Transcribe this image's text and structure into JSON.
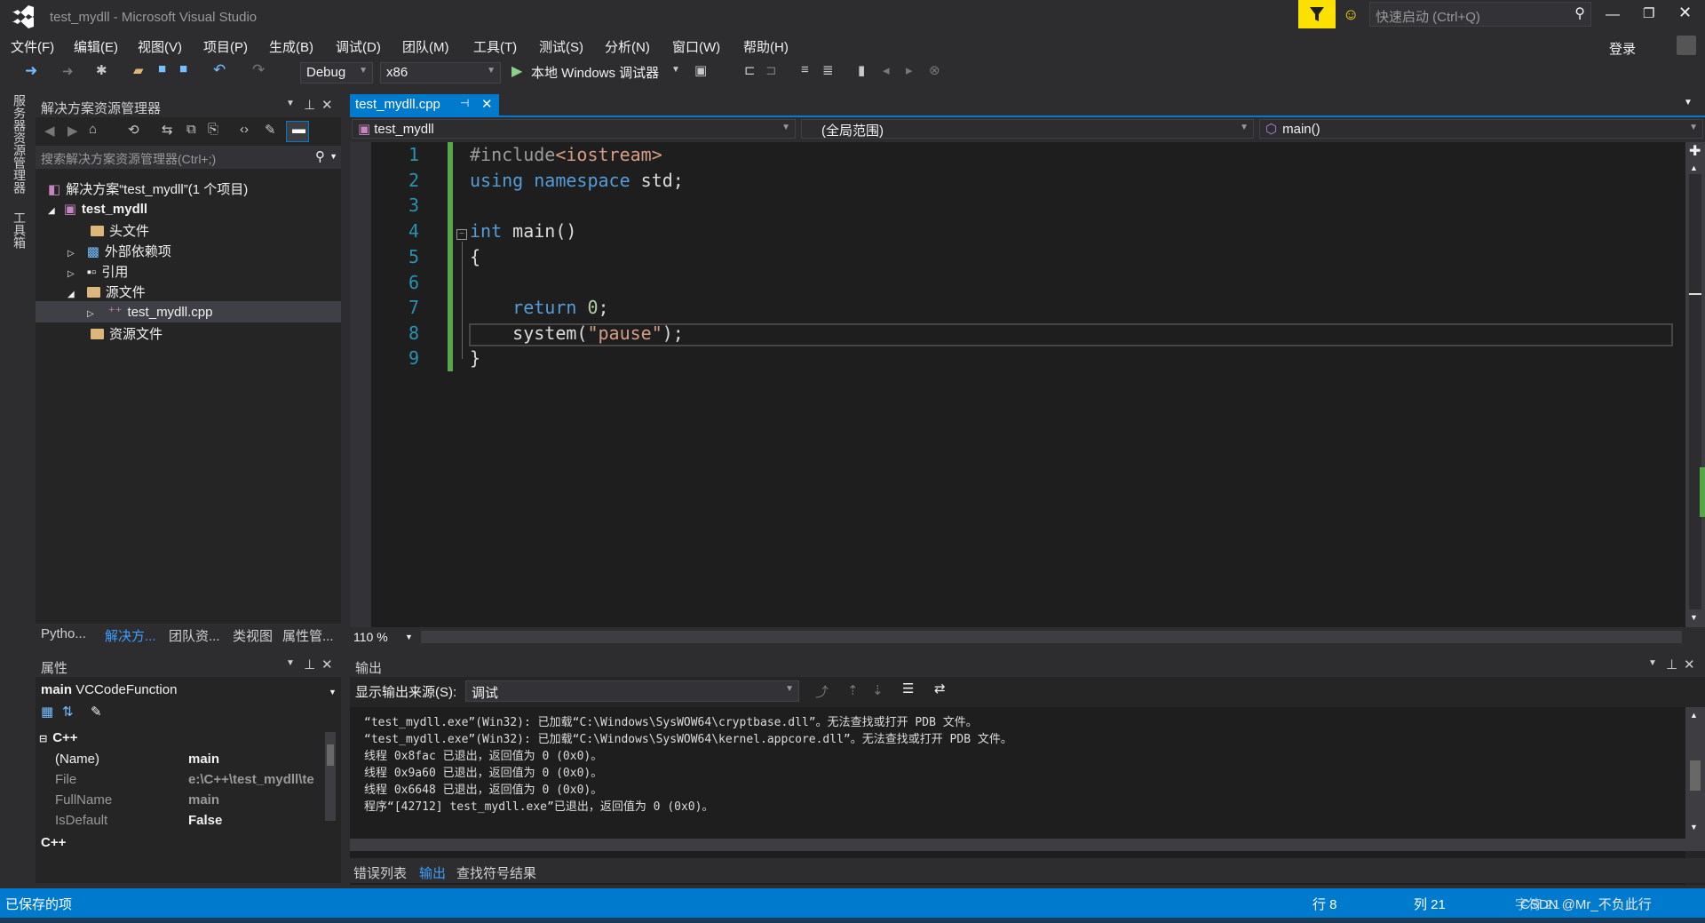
{
  "window": {
    "title": "test_mydll - Microsoft Visual Studio",
    "quick_launch_placeholder": "快速启动 (Ctrl+Q)",
    "signin": "登录"
  },
  "menu": [
    "文件(F)",
    "编辑(E)",
    "视图(V)",
    "项目(P)",
    "生成(B)",
    "调试(D)",
    "团队(M)",
    "工具(T)",
    "测试(S)",
    "分析(N)",
    "窗口(W)",
    "帮助(H)"
  ],
  "toolbar": {
    "config": "Debug",
    "platform": "x86",
    "run_label": "本地 Windows 调试器"
  },
  "left_strip": {
    "server_explorer": "服务器资源管理器",
    "toolbox": "工具箱"
  },
  "solution_explorer": {
    "title": "解决方案资源管理器",
    "search_placeholder": "搜索解决方案资源管理器(Ctrl+;)",
    "solution": "解决方案“test_mydll”(1 个项目)",
    "project": "test_mydll",
    "items": [
      "头文件",
      "外部依赖项",
      "引用",
      "源文件",
      "test_mydll.cpp",
      "资源文件"
    ],
    "bottom_tabs": [
      "Pytho...",
      "解决方...",
      "团队资...",
      "类视图",
      "属性管..."
    ]
  },
  "properties": {
    "title": "属性",
    "object_name": "main",
    "object_type": "VCCodeFunction",
    "category": "C++",
    "rows": [
      {
        "name": "(Name)",
        "value": "main"
      },
      {
        "name": "File",
        "value": "e:\\C++\\test_mydll\\te"
      },
      {
        "name": "FullName",
        "value": "main"
      },
      {
        "name": "IsDefault",
        "value": "False"
      }
    ],
    "description": "C++"
  },
  "editor": {
    "tab": "test_mydll.cpp",
    "nav_project": "test_mydll",
    "nav_scope": "(全局范围)",
    "nav_member": "main()",
    "zoom": "110 %",
    "line_numbers": [
      "1",
      "2",
      "3",
      "4",
      "5",
      "6",
      "7",
      "8",
      "9"
    ]
  },
  "output": {
    "title": "输出",
    "source_label": "显示输出来源(S):",
    "source_value": "调试",
    "lines": [
      "“test_mydll.exe”(Win32): 已加载“C:\\Windows\\SysWOW64\\cryptbase.dll”。无法查找或打开 PDB 文件。",
      "“test_mydll.exe”(Win32): 已加载“C:\\Windows\\SysWOW64\\kernel.appcore.dll”。无法查找或打开 PDB 文件。",
      "线程 0x8fac 已退出，返回值为 0 (0x0)。",
      "线程 0x9a60 已退出，返回值为 0 (0x0)。",
      "线程 0x6648 已退出，返回值为 0 (0x0)。",
      "程序“[42712] test_mydll.exe”已退出，返回值为 0 (0x0)。"
    ],
    "bottom_tabs": [
      "错误列表",
      "输出",
      "查找符号结果"
    ]
  },
  "status": {
    "left": "已保存的项",
    "row": "行 8",
    "col": "列 21",
    "char": "字符 21",
    "overlay": "CSDN @Mr_不负此行"
  },
  "colors": {
    "accent": "#007acc",
    "bg": "#2d2d30",
    "editor_bg": "#1e1e1e"
  }
}
